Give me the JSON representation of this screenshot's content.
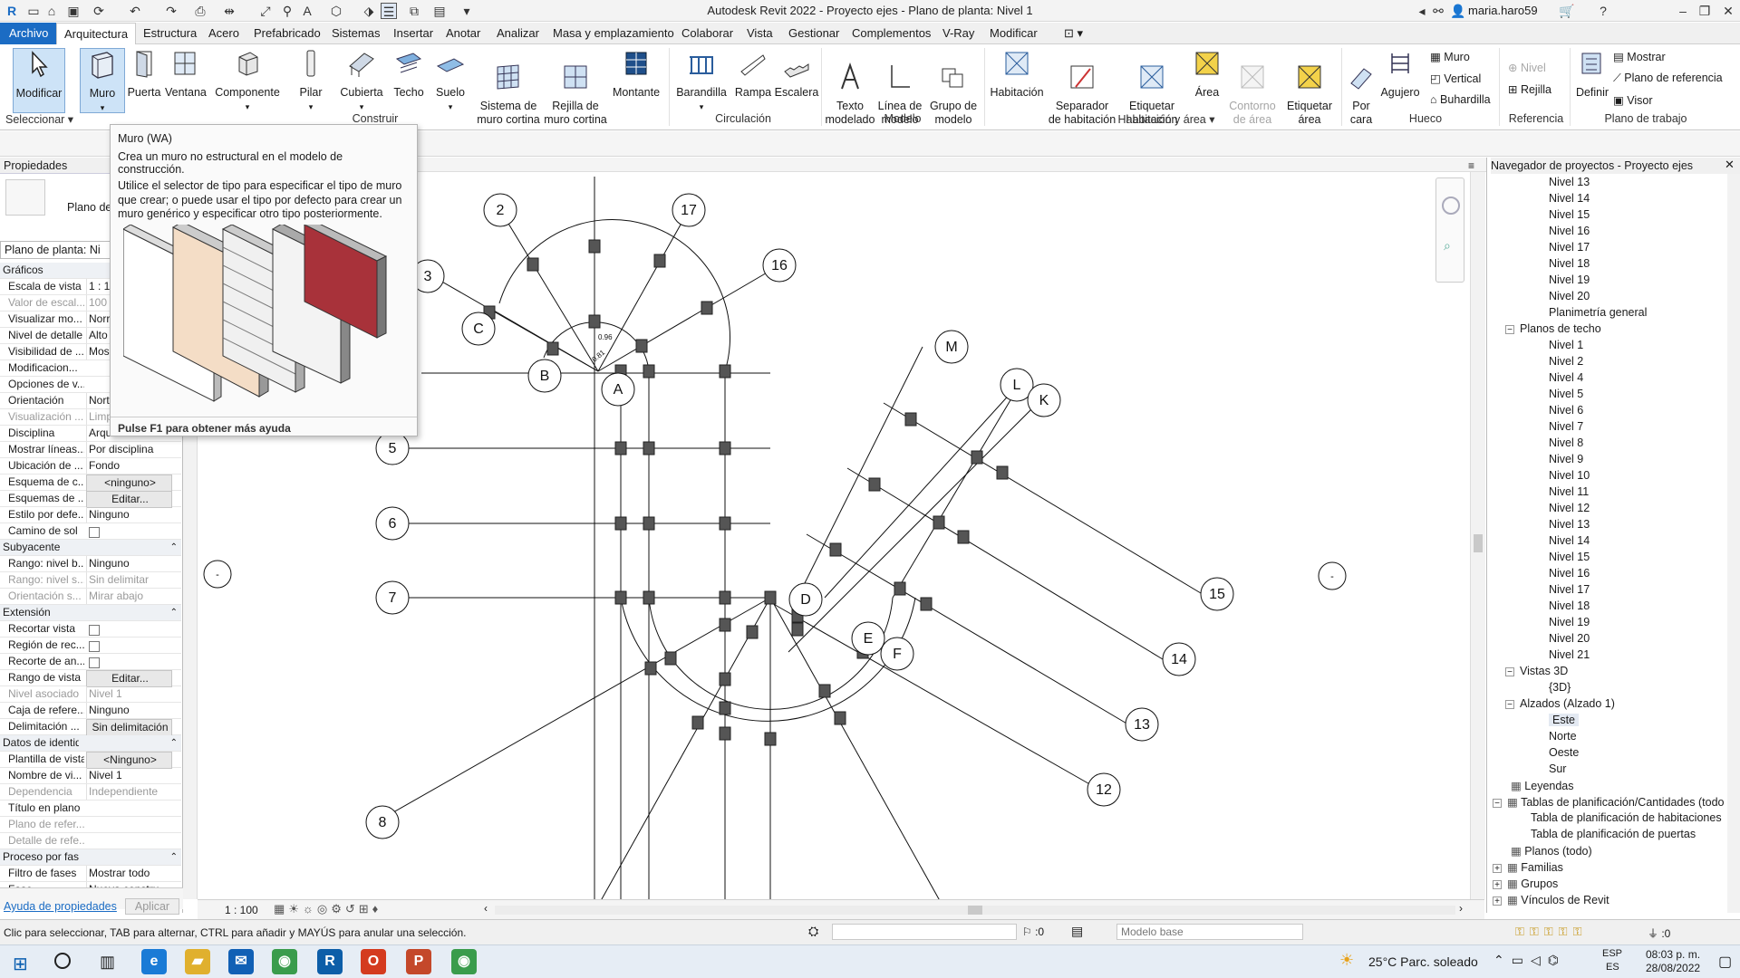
{
  "titlebar": {
    "title": "Autodesk Revit 2022 - Proyecto ejes - Plano de planta: Nivel 1",
    "user": "maria.haro59"
  },
  "menu": {
    "file": "Archivo",
    "tabs": [
      "Arquitectura",
      "Estructura",
      "Acero",
      "Prefabricado",
      "Sistemas",
      "Insertar",
      "Anotar",
      "Analizar",
      "Masa y emplazamiento",
      "Colaborar",
      "Vista",
      "Gestionar",
      "Complementos",
      "V-Ray",
      "Modificar"
    ]
  },
  "ribbon": {
    "buttons": {
      "modificar": "Modificar",
      "muro": "Muro",
      "puerta": "Puerta",
      "ventana": "Ventana",
      "componente": "Componente",
      "pilar": "Pilar",
      "cubierta": "Cubierta",
      "techo": "Techo",
      "suelo": "Suelo",
      "sistema_muro_cortina": "Sistema de\nmuro cortina",
      "rejilla_muro_cortina": "Rejilla de\nmuro cortina",
      "montante": "Montante",
      "barandilla": "Barandilla",
      "rampa": "Rampa",
      "escalera": "Escalera",
      "texto_modelado": "Texto\nmodelado",
      "linea_modelo": "Línea de\nmodelo",
      "grupo_modelo": "Grupo de\nmodelo",
      "habitacion": "Habitación",
      "separador_habitacion": "Separador\nde habitación",
      "etiquetar_habitacion": "Etiquetar\nhabitación",
      "area": "Área",
      "contorno_area": "Contorno\nde área",
      "etiquetar_area": "Etiquetar\nárea",
      "por_cara": "Por\ncara",
      "agujero": "Agujero",
      "h_muro": "Muro",
      "h_vertical": "Vertical",
      "h_buhardilla": "Buhardilla",
      "r_nivel": "Nivel",
      "r_rejilla": "Rejilla",
      "definir": "Definir",
      "mostrar": "Mostrar",
      "plano_referencia": "Plano de referencia",
      "visor": "Visor"
    },
    "groups": {
      "seleccionar": "Seleccionar",
      "construir": "Construir",
      "circulacion": "Circulación",
      "modelo": "Modelo",
      "habitacion_area": "Habitación y área",
      "hueco": "Hueco",
      "referencia": "Referencia",
      "plano_trabajo": "Plano de trabajo"
    }
  },
  "tooltip": {
    "title": "Muro (WA)",
    "line1": "Crea un muro no estructural en el modelo de construcción.",
    "body": "Utilice el selector de tipo para especificar el tipo de muro que crear; o puede usar el tipo por defecto para crear un muro genérico y especificar otro tipo posteriormente.",
    "help": "Pulse F1 para obtener más ayuda"
  },
  "properties": {
    "header": "Propiedades",
    "type_name": "Plano de",
    "selector": "Plano de planta: Ni",
    "sections": {
      "graficos": "Gráficos",
      "subyacente": "Subyacente",
      "extension": "Extensión",
      "identidad": "Datos de identidad",
      "fases": "Proceso por fases"
    },
    "graficos": [
      {
        "k": "Escala de vista",
        "v": "1 : 1"
      },
      {
        "k": "Valor de escal...",
        "v": "100"
      },
      {
        "k": "Visualizar mo...",
        "v": "Norr"
      },
      {
        "k": "Nivel de detalle",
        "v": "Alto"
      },
      {
        "k": "Visibilidad de ...",
        "v": "Mos"
      },
      {
        "k": "Modificacion...",
        "v": ""
      },
      {
        "k": "Opciones de v...",
        "v": ""
      },
      {
        "k": "Orientación",
        "v": "Nort"
      },
      {
        "k": "Visualización ...",
        "v": "Limp"
      },
      {
        "k": "Disciplina",
        "v": "Arqu"
      },
      {
        "k": "Mostrar líneas...",
        "v": "Por disciplina"
      },
      {
        "k": "Ubicación de ...",
        "v": "Fondo"
      },
      {
        "k": "Esquema de c...",
        "v": "<ninguno>"
      },
      {
        "k": "Esquemas de ...",
        "v": "Editar..."
      },
      {
        "k": "Estilo por defe...",
        "v": "Ninguno"
      },
      {
        "k": "Camino de sol",
        "v": ""
      }
    ],
    "subyacente": [
      {
        "k": "Rango: nivel b...",
        "v": "Ninguno"
      },
      {
        "k": "Rango: nivel s...",
        "v": "Sin delimitar"
      },
      {
        "k": "Orientación s...",
        "v": "Mirar abajo"
      }
    ],
    "extension": [
      {
        "k": "Recortar vista",
        "v": ""
      },
      {
        "k": "Región de rec...",
        "v": ""
      },
      {
        "k": "Recorte de an...",
        "v": ""
      },
      {
        "k": "Rango de vista",
        "v": "Editar..."
      },
      {
        "k": "Nivel asociado",
        "v": "Nivel 1"
      },
      {
        "k": "Caja de refere...",
        "v": "Ninguno"
      },
      {
        "k": "Delimitación ...",
        "v": "Sin delimitación"
      }
    ],
    "identidad": [
      {
        "k": "Plantilla de vista",
        "v": "<Ninguno>"
      },
      {
        "k": "Nombre de vi...",
        "v": "Nivel 1"
      },
      {
        "k": "Dependencia",
        "v": "Independiente"
      },
      {
        "k": "Título en plano",
        "v": ""
      },
      {
        "k": "Plano de refer...",
        "v": ""
      },
      {
        "k": "Detalle de refe...",
        "v": ""
      }
    ],
    "fases": [
      {
        "k": "Filtro de fases",
        "v": "Mostrar todo"
      },
      {
        "k": "Fase",
        "v": "Nueva constru..."
      }
    ],
    "help_link": "Ayuda de propiedades",
    "apply": "Aplicar"
  },
  "navigator": {
    "header": "Navegador de proyectos - Proyecto ejes",
    "items": [
      "Nivel 13",
      "Nivel 14",
      "Nivel 15",
      "Nivel 16",
      "Nivel 17",
      "Nivel 18",
      "Nivel 19",
      "Nivel 20",
      "Planimetría general",
      "Planos de techo",
      "Nivel 1",
      "Nivel 2",
      "Nivel 4",
      "Nivel 5",
      "Nivel 6",
      "Nivel 7",
      "Nivel 8",
      "Nivel 9",
      "Nivel 10",
      "Nivel 11",
      "Nivel 12",
      "Nivel 13",
      "Nivel 14",
      "Nivel 15",
      "Nivel 16",
      "Nivel 17",
      "Nivel 18",
      "Nivel 19",
      "Nivel 20",
      "Nivel 21",
      "Vistas 3D",
      "{3D}",
      "Alzados (Alzado 1)",
      "Este",
      "Norte",
      "Oeste",
      "Sur",
      "Leyendas",
      "Tablas de planificación/Cantidades (todo",
      "Tabla de planificación de habitaciones",
      "Tabla de planificación de puertas",
      "Planos (todo)",
      "Familias",
      "Grupos",
      "Vínculos de Revit"
    ]
  },
  "canvas": {
    "grid_labels": [
      "2",
      "17",
      "16",
      "3",
      "C",
      "B",
      "A",
      "M",
      "L",
      "K",
      "5",
      "6",
      "7",
      "D",
      "E",
      "F",
      "15",
      "14",
      "13",
      "12",
      "8"
    ],
    "dims": [
      "0.96",
      "0.81"
    ],
    "elev": [
      "-",
      "-"
    ]
  },
  "viewbar": {
    "scale": "1 : 100"
  },
  "status": {
    "hint": "Clic para seleccionar, TAB para alternar, CTRL para añadir y MAYÚS para anular una selección.",
    "zero": ":0",
    "model": "Modelo base",
    "filter": ":0"
  },
  "taskbar": {
    "weather": "25°C  Parc. soleado",
    "lang1": "ESP",
    "lang2": "ES",
    "time": "08:03 p. m.",
    "date": "28/08/2022"
  },
  "colors": {
    "accent": "#1b6cc4",
    "tab_bg": "#f0f0f0"
  }
}
